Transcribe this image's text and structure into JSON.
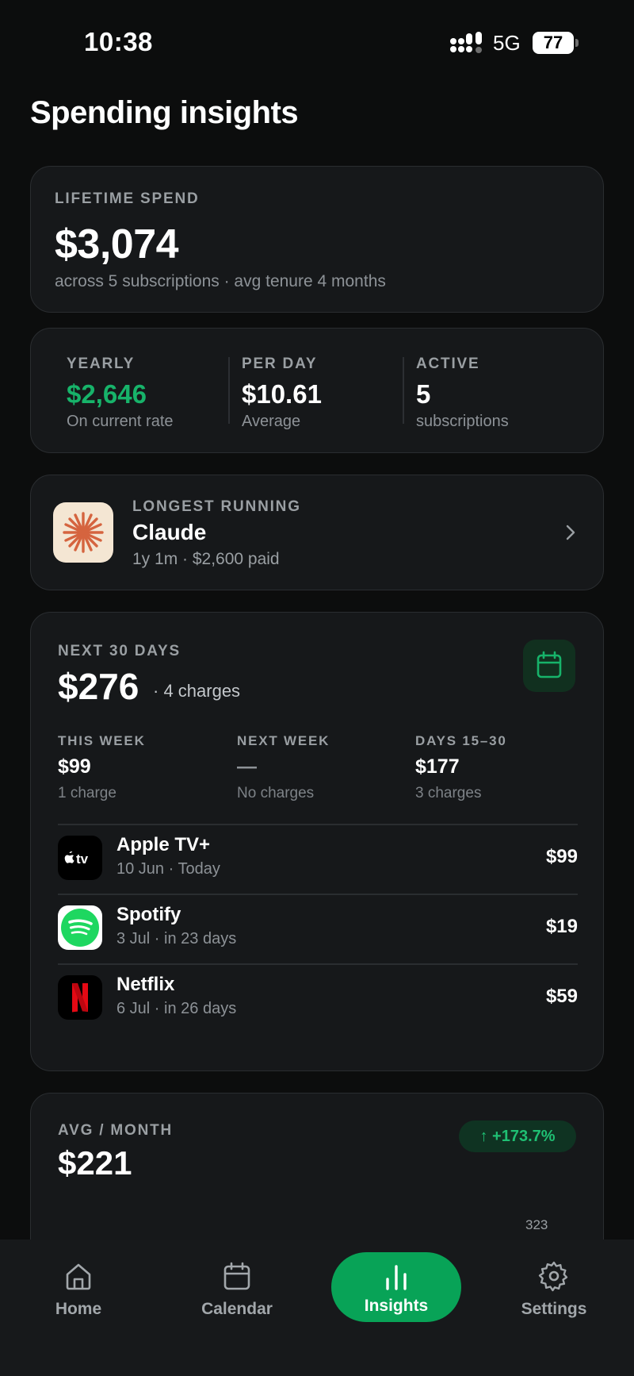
{
  "status": {
    "time": "10:38",
    "network": "5G",
    "battery": "77"
  },
  "page": {
    "title": "Spending insights"
  },
  "lifetime": {
    "label": "LIFETIME SPEND",
    "amount": "$3,074",
    "subtitle": "across 5 subscriptions · avg tenure 4 months"
  },
  "stats": [
    {
      "label": "YEARLY",
      "value": "$2,646",
      "caption": "On current rate"
    },
    {
      "label": "PER DAY",
      "value": "$10.61",
      "caption": "Average"
    },
    {
      "label": "ACTIVE",
      "value": "5",
      "caption": "subscriptions"
    }
  ],
  "longest": {
    "label": "LONGEST RUNNING",
    "name": "Claude",
    "meta": "1y 1m · $2,600 paid",
    "icon": "claude-asterisk-icon"
  },
  "next30": {
    "label": "NEXT 30 DAYS",
    "amount": "$276",
    "charges": "· 4 charges",
    "columns": [
      {
        "label": "THIS WEEK",
        "value": "$99",
        "caption": "1 charge"
      },
      {
        "label": "NEXT WEEK",
        "value": "—",
        "caption": "No charges"
      },
      {
        "label": "DAYS 15–30",
        "value": "$177",
        "caption": "3 charges"
      }
    ],
    "items": [
      {
        "name": "Apple TV+",
        "date": "10 Jun · Today",
        "amount": "$99",
        "icon": "apple-tv-icon"
      },
      {
        "name": "Spotify",
        "date": "3 Jul · in 23 days",
        "amount": "$19",
        "icon": "spotify-icon"
      },
      {
        "name": "Netflix",
        "date": "6 Jul · in 26 days",
        "amount": "$59",
        "icon": "netflix-icon"
      }
    ]
  },
  "avg": {
    "label": "AVG / MONTH",
    "amount": "$221",
    "change": "+173.7%",
    "peak_label": "323"
  },
  "tabs": [
    {
      "label": "Home",
      "icon": "home-icon"
    },
    {
      "label": "Calendar",
      "icon": "calendar-icon"
    },
    {
      "label": "Insights",
      "icon": "bar-chart-icon",
      "active": true
    },
    {
      "label": "Settings",
      "icon": "gear-icon"
    }
  ],
  "colors": {
    "accent": "#08a357",
    "positive": "#17b36a",
    "background": "#0c0d0d",
    "card": "#16181a"
  }
}
